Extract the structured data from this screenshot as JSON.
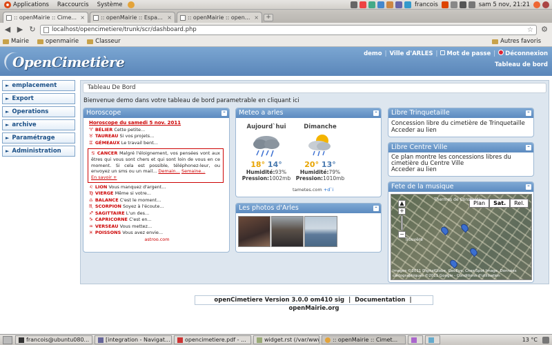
{
  "gnome_panel": {
    "applications": "Applications",
    "places": "Raccourcis",
    "system": "Système",
    "user": "francois",
    "clock": "sam  5 nov, 21:21"
  },
  "browser": {
    "tabs": [
      {
        "label": ":: openMairie :: Cime...",
        "active": true
      },
      {
        "label": ":: openMairie :: Espa...",
        "active": false
      },
      {
        "label": ":: openMairie :: open...",
        "active": false
      }
    ],
    "url": "localhost/opencimetiere/trunk/scr/dashboard.php",
    "bookmarks": [
      "Mairie",
      "openmairie",
      "Classeur"
    ],
    "other_bookmarks": "Autres favoris"
  },
  "app": {
    "logo": "OpenCimetière",
    "header_links": {
      "user": "demo",
      "city": "Ville d'ARLES",
      "password": "Mot de passe",
      "logout": "Déconnexion"
    },
    "dashboard_link": "Tableau de bord",
    "sidebar": [
      {
        "label": "emplacement"
      },
      {
        "label": "Export"
      },
      {
        "label": "Operations"
      },
      {
        "label": "archive"
      },
      {
        "label": "Paramétrage"
      },
      {
        "label": "Administration"
      }
    ],
    "page_title": "Tableau De Bord",
    "welcome": "Bienvenue demo dans votre tableau de bord parametrable en cliquant ici",
    "footer": {
      "version": "openCimetiere Version 3.0.0 om410 sig",
      "documentation": "Documentation",
      "site": "openMairie.org",
      "sep": "|"
    }
  },
  "widgets": {
    "horoscope": {
      "title": "Horoscope",
      "date": "Horoscope du samedi 5 nov. 2011",
      "signs_top": [
        {
          "sym": "♈",
          "name": "BÉLIER",
          "text": "Cette petite..."
        },
        {
          "sym": "♉",
          "name": "TAUREAU",
          "text": "Si vos projets..."
        },
        {
          "sym": "♊",
          "name": "GÉMEAUX",
          "text": "Le travail bent..."
        }
      ],
      "cancer": {
        "sym": "♋",
        "name": "CANCER",
        "text": "Malgré l'éloignement, vos pensées vont aux êtres qui vous sont chers et qui sont loin de vous en ce moment. Si cela est possible, téléphonez-leur, ou envoyez un sms ou un mail...",
        "link_tomorrow": "Demain...",
        "link_week": "Semaine...",
        "link_more": "En savoir +"
      },
      "signs_bottom": [
        {
          "sym": "♌",
          "name": "LION",
          "text": "Vous manquez d'argent..."
        },
        {
          "sym": "♍",
          "name": "VIERGE",
          "text": "Même si votre..."
        },
        {
          "sym": "♎",
          "name": "BALANCE",
          "text": "C'est le moment..."
        },
        {
          "sym": "♏",
          "name": "SCORPION",
          "text": "Soyez à l'écoute..."
        },
        {
          "sym": "♐",
          "name": "SAGITTAIRE",
          "text": "L'un des..."
        },
        {
          "sym": "♑",
          "name": "CAPRICORNE",
          "text": "C'est en..."
        },
        {
          "sym": "♒",
          "name": "VERSEAU",
          "text": "Vous mettez..."
        },
        {
          "sym": "♓",
          "name": "POISSONS",
          "text": "Vous avez envie..."
        }
      ],
      "source": "astroo.com"
    },
    "meteo": {
      "title": "Meteo a arles",
      "days": [
        {
          "name": "Aujourd`hui",
          "icon": "rain-cloud-icon",
          "hi": "18°",
          "lo": "14°",
          "humidity_label": "Humidité:",
          "humidity": "93%",
          "pressure_label": "Pression:",
          "pressure": "1002mb"
        },
        {
          "name": "Dimanche",
          "icon": "sun-rain-cloud-icon",
          "hi": "20°",
          "lo": "13°",
          "humidity_label": "Humidité:",
          "humidity": "79%",
          "pressure_label": "Pression:",
          "pressure": "1010mb"
        }
      ],
      "source": "tametes.com",
      "more": "+d`i"
    },
    "photos": {
      "title": "Les photos d'Arles"
    },
    "trinquetaille": {
      "title": "Libre Trinquetaille",
      "text": "Concession libre du cimetière de Trinquetaille",
      "link": "Acceder au lien"
    },
    "centre_ville": {
      "title": "Libre Centre Ville",
      "text": "Ce plan montre les concessions libres du cimetière du Centre Ville",
      "link": "Acceder au lien"
    },
    "fete": {
      "title": "Fete de la musique",
      "map_types": [
        "Plan",
        "Sat.",
        "Rel."
      ],
      "selected_type": "Sat.",
      "label_top": "Thermes de Constantin",
      "label_mid": "Trouvère",
      "caption": "Images ©2011 DigitalGlobe, GeoEye, Cnes/Spot Image, Données cartographiques ©2011 Google - Conditions d'utilisation"
    }
  },
  "taskbar": [
    {
      "label": "francois@ubuntu080..."
    },
    {
      "label": "[integration - Navigat..."
    },
    {
      "label": "opencimetiere.pdf - ..."
    },
    {
      "label": "widget.rst (/var/www/..."
    },
    {
      "label": ":: openMairie :: Cimet..."
    }
  ],
  "taskbar_temp": "13 °C"
}
